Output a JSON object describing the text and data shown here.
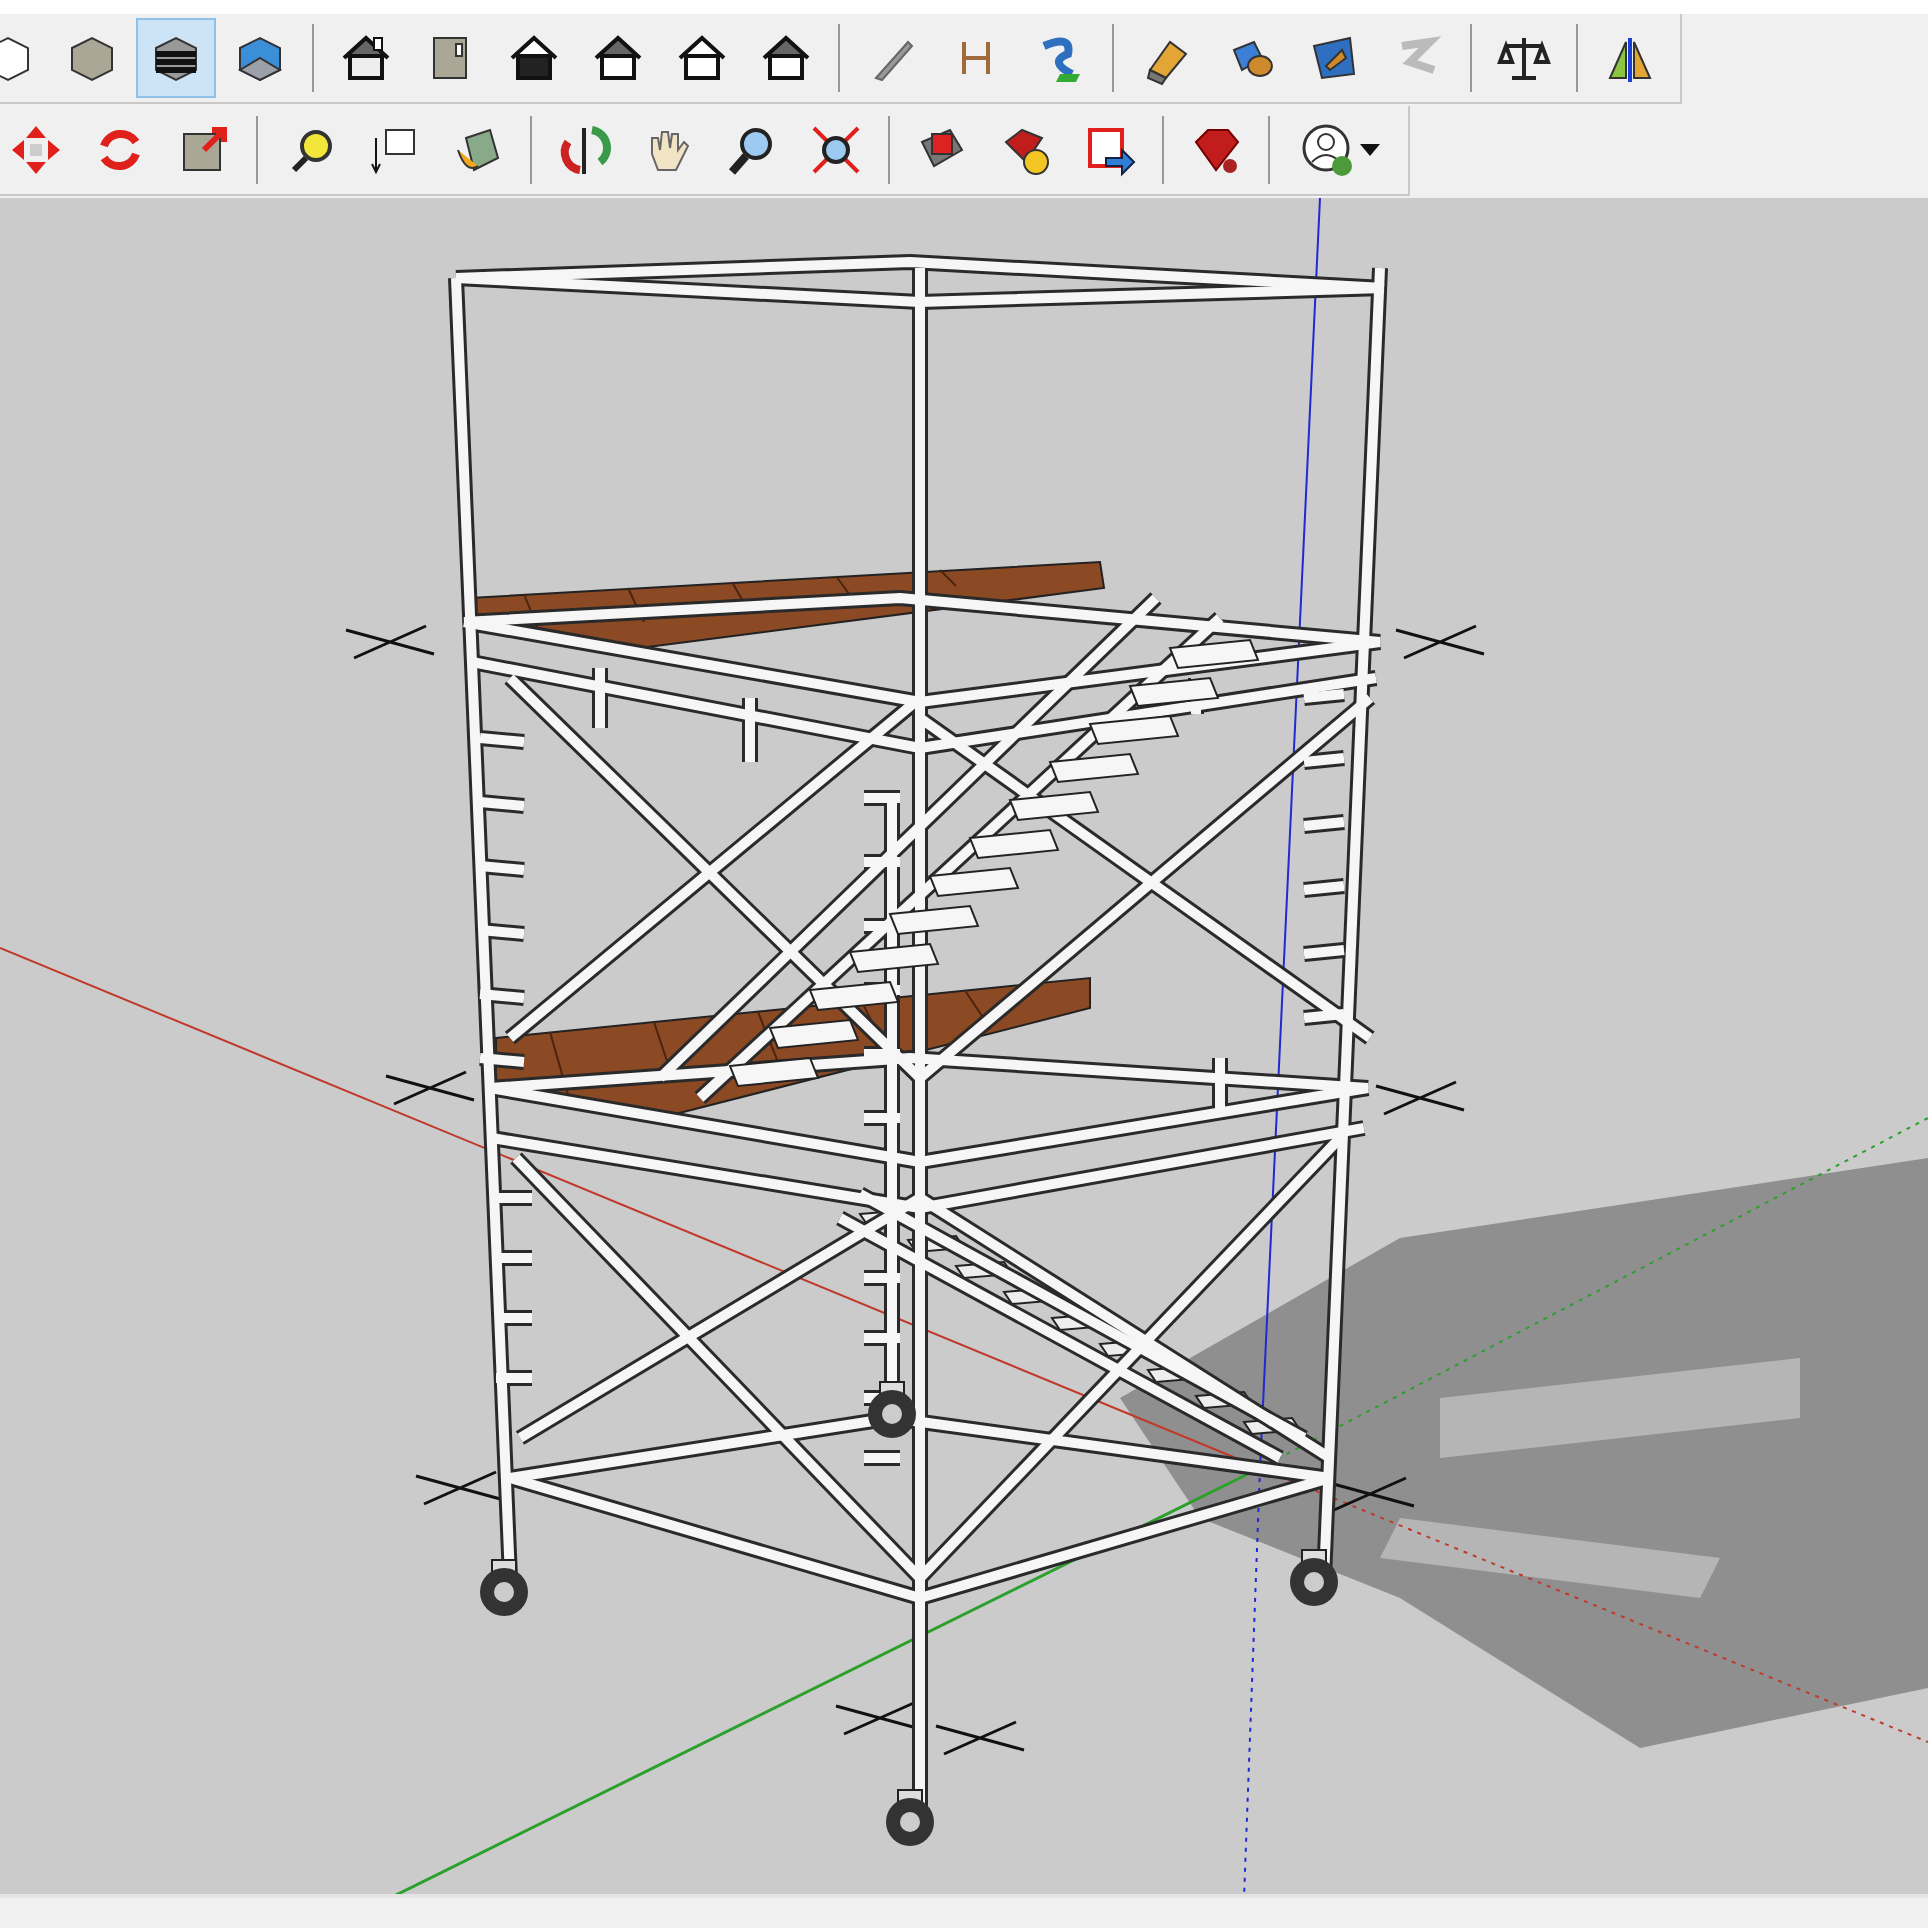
{
  "toolbars": [
    {
      "groups": [
        [
          {
            "kind": "xray",
            "selected": false
          },
          {
            "kind": "shaded",
            "selected": false
          },
          {
            "kind": "textured",
            "selected": true
          },
          {
            "kind": "monochrome",
            "selected": false
          }
        ],
        [
          {
            "kind": "iso",
            "selected": false
          },
          {
            "kind": "top",
            "selected": false
          },
          {
            "kind": "front",
            "selected": false
          },
          {
            "kind": "right",
            "selected": false
          },
          {
            "kind": "back",
            "selected": false
          },
          {
            "kind": "left",
            "selected": false
          }
        ],
        [
          {
            "kind": "section",
            "selected": false
          },
          {
            "kind": "dimension",
            "selected": false
          },
          {
            "kind": "followme",
            "selected": false
          }
        ],
        [
          {
            "kind": "push",
            "selected": false
          },
          {
            "kind": "intersect",
            "selected": false
          },
          {
            "kind": "offset",
            "selected": false
          },
          {
            "kind": "sandbox",
            "selected": false
          }
        ],
        [
          {
            "kind": "balance",
            "selected": false
          }
        ],
        [
          {
            "kind": "mirror",
            "selected": false
          }
        ]
      ]
    },
    {
      "groups": [
        [
          {
            "kind": "move",
            "selected": false
          },
          {
            "kind": "rotate",
            "selected": false
          },
          {
            "kind": "scale",
            "selected": false
          }
        ],
        [
          {
            "kind": "tape",
            "selected": false
          },
          {
            "kind": "text",
            "selected": false
          },
          {
            "kind": "paint",
            "selected": false
          }
        ],
        [
          {
            "kind": "orbit",
            "selected": false
          },
          {
            "kind": "pan",
            "selected": false
          },
          {
            "kind": "zoom",
            "selected": false
          },
          {
            "kind": "extents",
            "selected": false
          }
        ],
        [
          {
            "kind": "warehouse",
            "selected": false
          },
          {
            "kind": "extension",
            "selected": false
          },
          {
            "kind": "export",
            "selected": false
          }
        ],
        [
          {
            "kind": "ruby",
            "selected": false
          }
        ],
        [
          {
            "kind": "account",
            "selected": false,
            "has_menu": true
          }
        ]
      ]
    }
  ],
  "viewport": {
    "axes": true,
    "shadows": true
  }
}
